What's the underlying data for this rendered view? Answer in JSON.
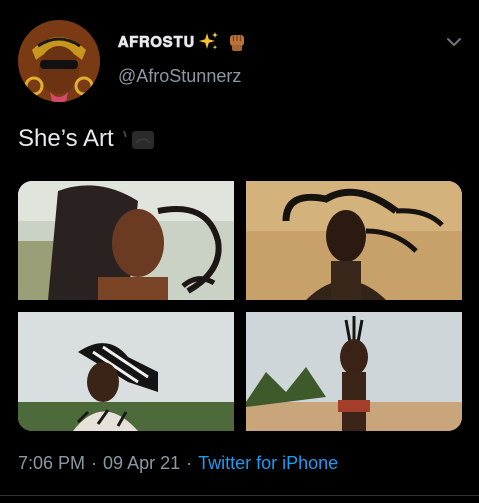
{
  "tweet": {
    "author": {
      "display_name": "𝐀𝐅𝐑𝐎𝐒𝐓𝐔",
      "handle": "@AfroStunnerz"
    },
    "text": "She’s Art",
    "time": "7:06 PM",
    "separator": "·",
    "date": "09 Apr 21",
    "source": "Twitter for iPhone"
  },
  "icons": {
    "display_name_emoji_1": "sparkles-icon",
    "display_name_emoji_2": "raised-fist-icon",
    "menu": "chevron-down-icon",
    "text_emoji": "emoji-icon"
  },
  "colors": {
    "background": "#000000",
    "text_primary": "#e7e9ea",
    "text_secondary": "#8b98a5",
    "link": "#1d9bf0",
    "divider": "#2f3336"
  }
}
